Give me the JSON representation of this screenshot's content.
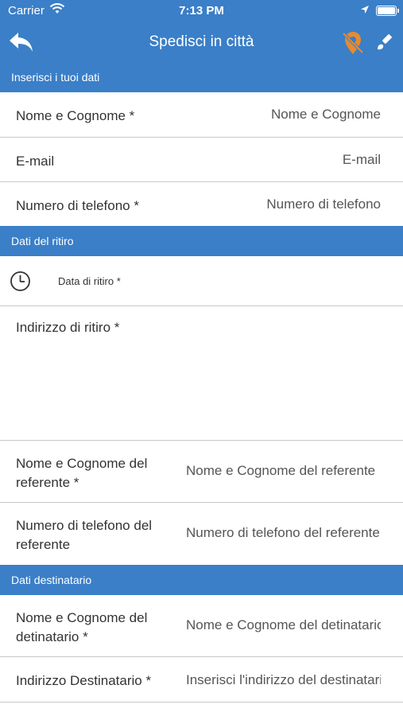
{
  "status_bar": {
    "carrier": "Carrier",
    "time": "7:13 PM"
  },
  "nav": {
    "title": "Spedisci in città",
    "back_icon": "back-arrow-icon",
    "location_off_icon": "location-off-icon",
    "brush_icon": "brush-icon",
    "accent_color": "#3a7fc8",
    "location_off_color": "#e88a2e"
  },
  "sections": {
    "personal": "Inserisci i tuoi dati",
    "pickup": "Dati del ritiro",
    "recipient": "Dati destinatario"
  },
  "fields": {
    "name": {
      "label": "Nome e Cognome *",
      "placeholder": "Nome e Cognome"
    },
    "email": {
      "label": "E-mail",
      "placeholder": "E-mail"
    },
    "phone": {
      "label": "Numero di telefono *",
      "placeholder": "Numero di telefono"
    },
    "pickup_date": {
      "label": "Data di ritiro *",
      "icon": "clock-icon"
    },
    "pickup_address": {
      "label": "Indirizzo di ritiro *"
    },
    "referent_name": {
      "label": "Nome e Cognome del referente *",
      "placeholder": "Nome e Cognome del referente"
    },
    "referent_phone": {
      "label": "Numero di telefono del referente",
      "placeholder": "Numero di telefono del referente"
    },
    "recipient_name": {
      "label": "Nome e Cognome del detinatario *",
      "placeholder": "Nome e Cognome del detinatario"
    },
    "recipient_address": {
      "label": "Indirizzo Destinatario *",
      "placeholder": "Inserisci l'indirizzo del destinatario"
    }
  }
}
